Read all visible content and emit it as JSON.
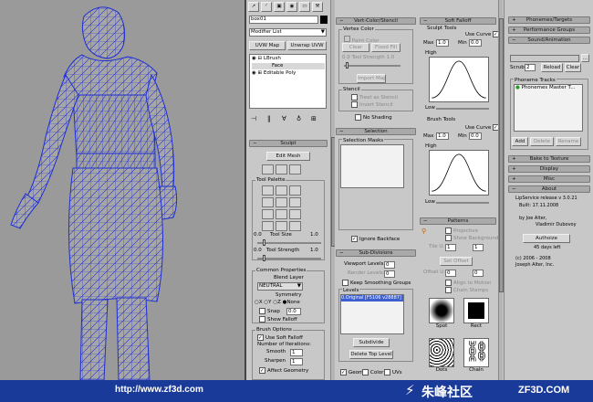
{
  "colors": {
    "viewport_bg": "#9a9a9a",
    "wire": "#1e2fd6",
    "banner": "#1a3a9a",
    "selection": "#3d5fd0"
  },
  "modifier": {
    "object_name": "box01",
    "modifier_list": "Modifier List",
    "uvw_map": "UVW Map",
    "unwrap_uvw": "Unwrap UVW",
    "stack": [
      "LBrush",
      "Face",
      "Editable Poly"
    ]
  },
  "sculpt": {
    "title": "Sculpt",
    "edit_mesh": "Edit Mesh",
    "tool_palette": "Tool Palette",
    "tool_size_label": "Tool Size",
    "tool_size_val": "1.0",
    "tool_size_min": "0.0",
    "tool_strength_label": "Tool Strength",
    "tool_strength_val": "1.0",
    "tool_strength_min": "0.0",
    "common_props": "Common Properties",
    "blend_layer": "Blend Layer",
    "blend_value": "NEUTRAL",
    "symmetry": "Symmetry",
    "axes": [
      "X",
      "Y",
      "Z",
      "None"
    ],
    "snap": "Snap",
    "snap_val": "0.0",
    "show_falloff": "Show Falloff",
    "brush_options": "Brush Options",
    "use_soft_falloff": "Use Soft Falloff",
    "num_iterations": "Number of Iterations:",
    "smooth": "Smooth",
    "smooth_val": "1",
    "sharpen": "Sharpen",
    "sharpen_val": "1",
    "affect_geometry": "Affect Geometry"
  },
  "vertcolor": {
    "title": "Vert-Color/Stencil",
    "vertex_color": "Vertex Color",
    "paint_color": "Paint Color",
    "clear": "Clear",
    "flood_fill": "Flood Fill",
    "tool_strength": "Tool Strength",
    "tool_strength_val": "1.0",
    "tool_strength_min": "0.0",
    "import_map": "Import Map",
    "stencil": "Stencil",
    "treat_as_stencil": "Treat as Stencil",
    "invert_stencil": "Invert Stencil",
    "no_shading": "No Shading"
  },
  "selection": {
    "title": "Selection",
    "masks": "Selection Masks",
    "ignore_backface": "Ignore Backface"
  },
  "subdiv": {
    "title": "Sub-Divisions",
    "viewport_levels": "Viewport Levels:",
    "viewport_val": "0",
    "render_levels": "Render Levels:",
    "render_val": "0",
    "keep_smoothing": "Keep Smoothing Groups",
    "levels": "Levels",
    "level_item": "0.Original [F5106 v28887]",
    "subdivide": "Subdivide",
    "delete_top": "Delete Top Level",
    "geom": "Geom",
    "color": "Color",
    "uvs": "UVs"
  },
  "softfalloff": {
    "title": "Soft Falloff",
    "sculpt_tools": "Sculpt Tools",
    "use_curve": "Use Curve",
    "max": "Max",
    "max_val": "1.0",
    "min": "Min",
    "min_val": "0.0",
    "high": "High",
    "low": "Low",
    "brush_tools": "Brush Tools",
    "b_max_val": "1.0",
    "b_min_val": "0.0"
  },
  "patterns": {
    "title": "Patterns",
    "projective": "Projective",
    "show_background": "Show Background",
    "tile_u": "Tile U:",
    "tile_u_val": "1",
    "tile_v_val": "1",
    "set_offset": "Set Offset",
    "offset_u": "Offset U:",
    "offset_u_val": "0",
    "offset_v_val": "0",
    "align_to_motion": "Align to Motion",
    "chain_stamps": "Chain Stamps",
    "stamps": [
      "Spot",
      "Rect",
      "Dots",
      "Chain"
    ]
  },
  "phonemes": {
    "targets": "Phonemes/Targets",
    "performance": "Performance Groups",
    "sound": "Sound/Animation",
    "scrub_label": "Scrub:",
    "scrub_val": "2",
    "reload": "Reload",
    "clear": "Clear",
    "tracks": "Phoneme Tracks",
    "track_item": "Phonemes Master T...",
    "add": "Add",
    "delete": "Delete",
    "rename": "Rename",
    "bake": "Bake to Texture",
    "display": "Display",
    "misc": "Misc",
    "about": "About",
    "release": "LipService release v 3.0.21",
    "built": "Built:  17.11.2008",
    "by": "by Joe Alter,",
    "author2": "Vladimir Dubovoy",
    "authorize": "Authoize",
    "days_left": "45 days left",
    "copyright": "(c) 2006 - 2008",
    "company": "Joseph Alter, Inc."
  },
  "banner": {
    "url": "http://www.zf3d.com",
    "chinese": "朱峰社区",
    "brand": "ZF3D.COM"
  }
}
